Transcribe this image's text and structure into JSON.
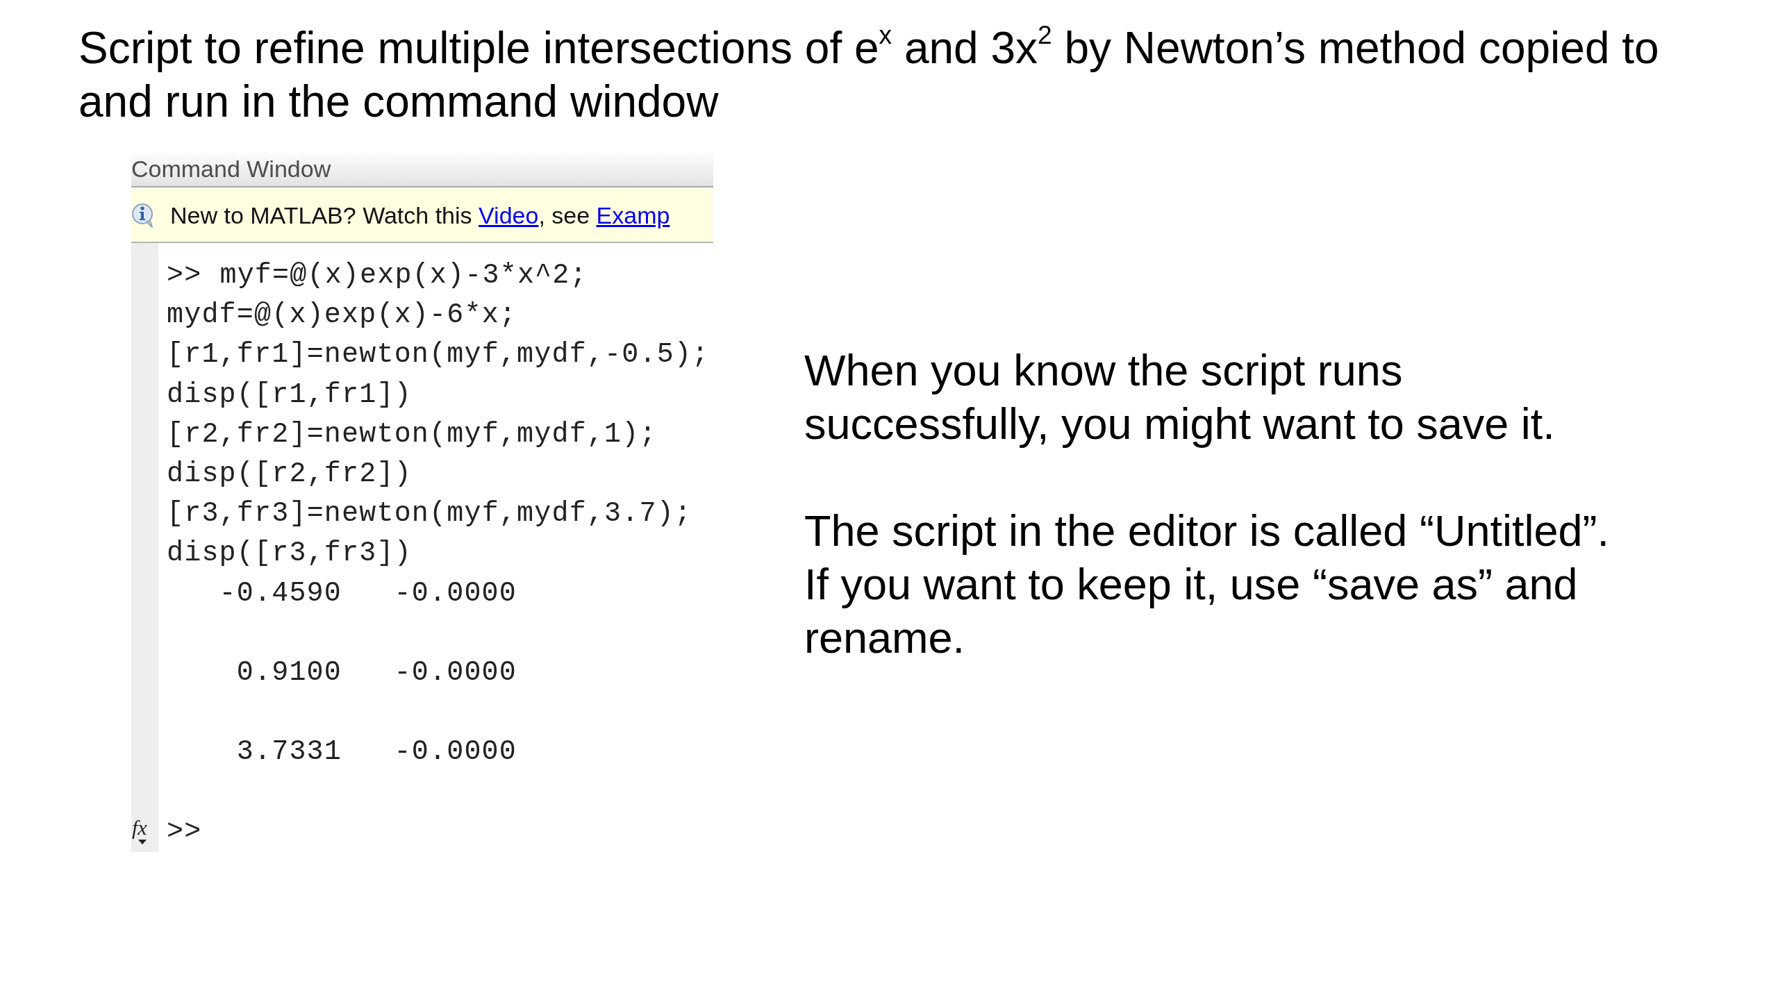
{
  "slide_title": "Script to refine multiple intersections of e$^{x}$ and 3x$^{2}$ by Newton’s method copied to and run in the command window",
  "command_window": {
    "title": "Command Window",
    "info_bar": {
      "parts": [
        {
          "kind": "text",
          "text": "New to MATLAB? Watch this "
        },
        {
          "kind": "link",
          "text": "Video"
        },
        {
          "kind": "text",
          "text": ", see "
        },
        {
          "kind": "link",
          "text": "Examp"
        }
      ]
    },
    "input_lines": [
      {
        "prompt": ">>",
        "text": "myf=@(x)exp(x)-3*x^2;"
      },
      {
        "text": "mydf=@(x)exp(x)-6*x;"
      },
      {
        "text": "[r1,fr1]=newton(myf,mydf,-0.5);"
      },
      {
        "text": "disp([r1,fr1])"
      },
      {
        "text": "[r2,fr2]=newton(myf,mydf,1);"
      },
      {
        "text": "disp([r2,fr2])"
      },
      {
        "text": "[r3,fr3]=newton(myf,mydf,3.7);"
      },
      {
        "text": "disp([r3,fr3])"
      }
    ],
    "output_rows": [
      {
        "values": [
          "-0.4590",
          "-0.0000"
        ]
      },
      {
        "values": [
          "0.9100",
          "-0.0000"
        ]
      },
      {
        "values": [
          "3.7331",
          "-0.0000"
        ]
      }
    ],
    "function_browser": "fx",
    "current_prompt": ">>"
  },
  "notes": [
    "When you know the script runs successfully, you might want to save it.",
    "The script in the editor is called “Untitled”. If you want to keep it, use “save as” and rename."
  ]
}
